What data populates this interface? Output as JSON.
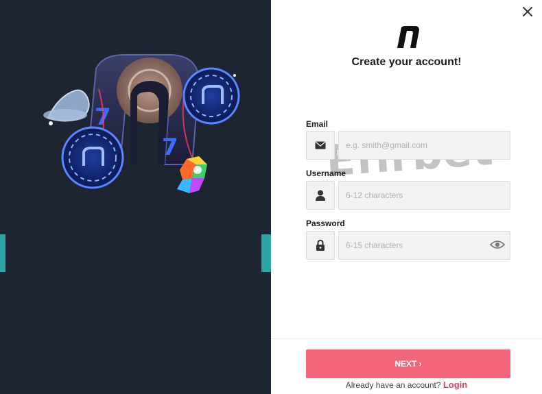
{
  "modal": {
    "title": "Create your account!",
    "watermark": "Efirbet"
  },
  "fields": {
    "email": {
      "label": "Email",
      "placeholder": "e.g. smith@gmail.com",
      "icon": "envelope-icon"
    },
    "username": {
      "label": "Username",
      "placeholder": "6-12 characters",
      "icon": "user-icon"
    },
    "password": {
      "label": "Password",
      "placeholder": "6-15 characters",
      "icon": "lock-icon"
    }
  },
  "actions": {
    "next_label": "NEXT ›",
    "already_text": "Already have an account? ",
    "login_label": "Login"
  },
  "colors": {
    "left_panel_bg": "#1d2533",
    "teal_accent": "#2ba6a4",
    "primary_button": "#f36679",
    "link": "#e0405b"
  }
}
